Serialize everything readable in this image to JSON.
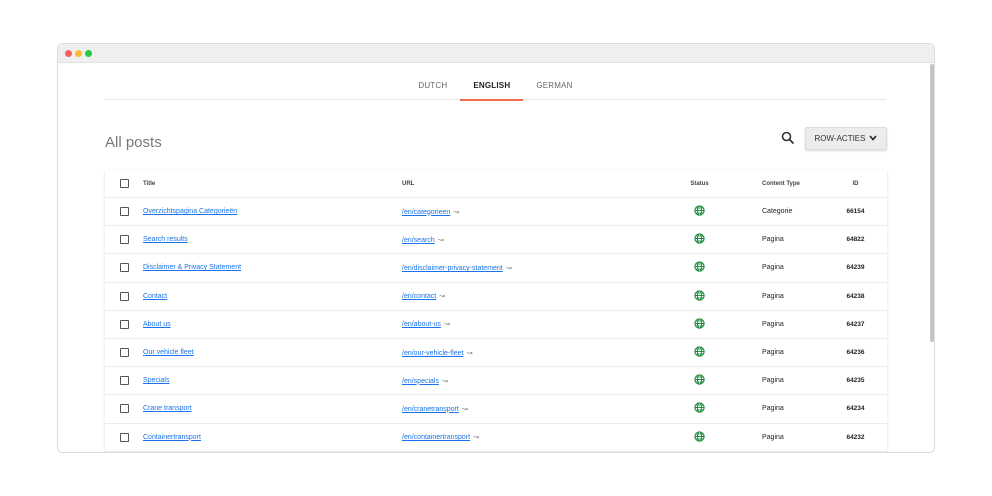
{
  "tabs": [
    {
      "label": "DUTCH",
      "active": false
    },
    {
      "label": "ENGLISH",
      "active": true
    },
    {
      "label": "GERMAN",
      "active": false
    }
  ],
  "page": {
    "title": "All posts"
  },
  "toolbar": {
    "row_actions_label": "ROW-ACTIES",
    "search_icon": "search-icon"
  },
  "table": {
    "headers": {
      "title": "Title",
      "url": "URL",
      "status": "Status",
      "content_type": "Content Type",
      "id": "ID"
    },
    "rows": [
      {
        "title": "Overzichtspagina Categorieën",
        "url": "/en/categorieen",
        "type": "Categorie",
        "id": "66154"
      },
      {
        "title": "Search results",
        "url": "/en/search",
        "type": "Pagina",
        "id": "64822"
      },
      {
        "title": "Disclaimer & Privacy Statement",
        "url": "/en/disclaimer-privacy-statement",
        "type": "Pagina",
        "id": "64239"
      },
      {
        "title": "Contact",
        "url": "/en/contact",
        "type": "Pagina",
        "id": "64238"
      },
      {
        "title": "About us",
        "url": "/en/about-us",
        "type": "Pagina",
        "id": "64237"
      },
      {
        "title": "Our vehicle fleet",
        "url": "/en/our-vehicle-fleet",
        "type": "Pagina",
        "id": "64236"
      },
      {
        "title": "Specials",
        "url": "/en/specials",
        "type": "Pagina",
        "id": "64235"
      },
      {
        "title": "Crane transport",
        "url": "/en/cranetransport",
        "type": "Pagina",
        "id": "64234"
      },
      {
        "title": "Containertransport",
        "url": "/en/containertransport",
        "type": "Pagina",
        "id": "64232"
      }
    ]
  },
  "colors": {
    "accent": "#f06b4a",
    "link": "#1a73e8",
    "status_published": "#1e8e3e"
  },
  "icons": {
    "status": "globe-icon",
    "external": "external-link-icon",
    "dropdown": "chevron-down-icon"
  }
}
